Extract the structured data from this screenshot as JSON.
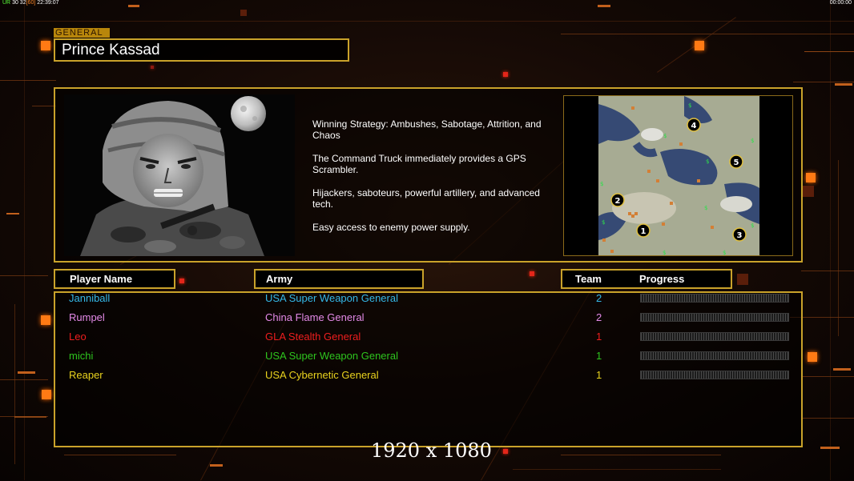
{
  "hud": {
    "fps_label": "UR",
    "fps_values": "30 32",
    "fps_bracket": "[60]",
    "clock": "22:39:07",
    "timer": "00:00:00"
  },
  "general": {
    "tag": "GENERAL",
    "name": "Prince Kassad"
  },
  "strategy": [
    "Winning Strategy: Ambushes, Sabotage, Attrition, and Chaos",
    "The Command Truck immediately provides a GPS Scrambler.",
    "Hijackers, saboteurs, powerful artillery, and advanced tech.",
    "Easy access to enemy power supply."
  ],
  "map": {
    "start_positions": [
      "1",
      "2",
      "3",
      "4",
      "5"
    ]
  },
  "table": {
    "headers": {
      "player": "Player Name",
      "army": "Army",
      "team": "Team",
      "progress": "Progress"
    },
    "rows": [
      {
        "name": "Janniball",
        "army": "USA Super Weapon General",
        "team": "2",
        "color": "#35b8e8"
      },
      {
        "name": "Rumpel",
        "army": "China Flame General",
        "team": "2",
        "color": "#e48ae8"
      },
      {
        "name": "Leo",
        "army": "GLA Stealth General",
        "team": "1",
        "color": "#ee1e1e"
      },
      {
        "name": "michi",
        "army": "USA Super Weapon General",
        "team": "1",
        "color": "#2ec41e"
      },
      {
        "name": "Reaper",
        "army": "USA Cybernetic General",
        "team": "1",
        "color": "#e8d21e"
      }
    ]
  },
  "resolution": "1920 x 1080"
}
